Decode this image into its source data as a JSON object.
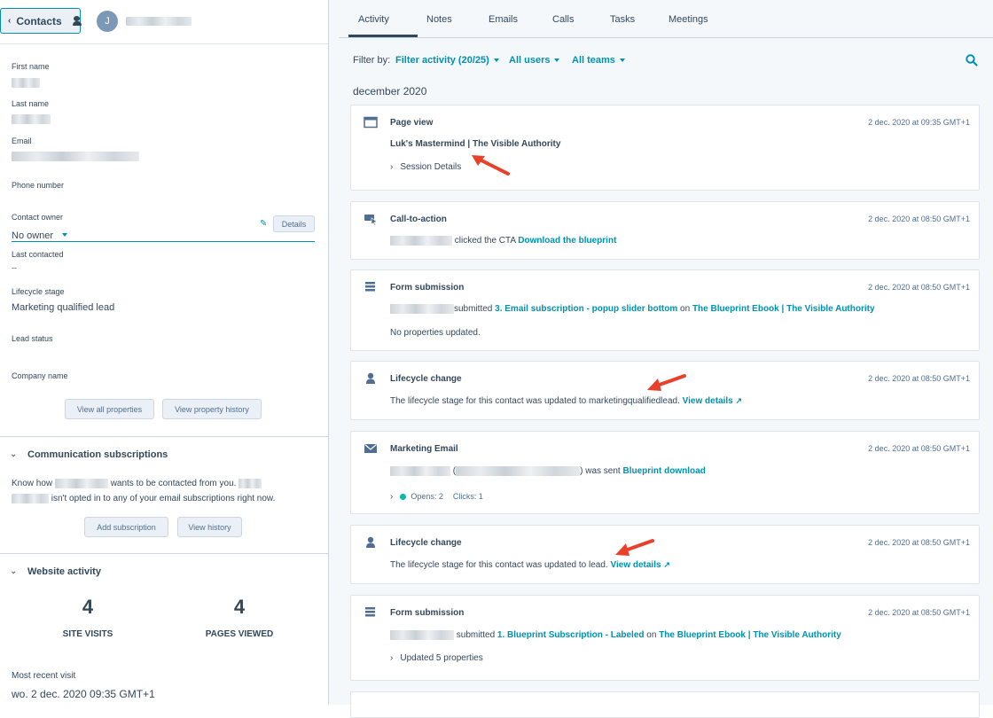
{
  "left": {
    "contacts_button": "Contacts",
    "avatar_initial": "J",
    "properties": [
      {
        "label": "First name",
        "value": ""
      },
      {
        "label": "Last name",
        "value": ""
      },
      {
        "label": "Email",
        "value": ""
      },
      {
        "label": "Phone number",
        "value": ""
      },
      {
        "label": "Contact owner",
        "value": "No owner"
      },
      {
        "label": "Last contacted",
        "value": "--"
      },
      {
        "label": "Lifecycle stage",
        "value": "Marketing qualified lead"
      },
      {
        "label": "Lead status",
        "value": ""
      },
      {
        "label": "Company name",
        "value": ""
      }
    ],
    "details_button": "Details",
    "view_all_properties": "View all properties",
    "view_property_history": "View property history",
    "comm": {
      "title": "Communication subscriptions",
      "text1a": "Know how",
      "text1b": "wants to be contacted from you.",
      "text2": "isn't opted in to any of your email subscriptions right now.",
      "add_subscription": "Add subscription",
      "view_history": "View history"
    },
    "website": {
      "title": "Website activity",
      "site_visits_value": "4",
      "site_visits_label": "SITE VISITS",
      "pages_viewed_value": "4",
      "pages_viewed_label": "PAGES VIEWED",
      "most_recent_label": "Most recent visit",
      "most_recent_value": "wo. 2 dec. 2020 09:35 GMT+1"
    }
  },
  "right": {
    "tabs": [
      "Activity",
      "Notes",
      "Emails",
      "Calls",
      "Tasks",
      "Meetings"
    ],
    "filter_by": "Filter by:",
    "filter_activity": "Filter activity (20/25)",
    "all_users": "All users",
    "all_teams": "All teams",
    "month": "december 2020",
    "cards": [
      {
        "icon": "browser-window-icon",
        "title": "Page view",
        "time": "2 dec. 2020 at 09:35 GMT+1",
        "link": "Luk's Mastermind | The Visible Authority",
        "sub": "Session Details"
      },
      {
        "icon": "cta-cursor-icon",
        "title": "Call-to-action",
        "time": "2 dec. 2020 at 08:50 GMT+1",
        "text": "clicked the CTA",
        "link": "Download the blueprint"
      },
      {
        "icon": "form-icon",
        "title": "Form submission",
        "time": "2 dec. 2020 at 08:50 GMT+1",
        "text": "submitted",
        "link": "3. Email subscription - popup slider bottom",
        "on": "on",
        "link2": "The Blueprint Ebook | The Visible Authority",
        "sub": "No properties updated."
      },
      {
        "icon": "person-icon",
        "title": "Lifecycle change",
        "time": "2 dec. 2020 at 08:50 GMT+1",
        "text": "The lifecycle stage for this contact was updated to marketingqualifiedlead.",
        "link": "View details"
      },
      {
        "icon": "envelope-icon",
        "title": "Marketing Email",
        "time": "2 dec. 2020 at 08:50 GMT+1",
        "text_a": "(",
        "text_b": ") was sent",
        "link": "Blueprint download",
        "opens": "Opens: 2",
        "clicks": "Clicks: 1"
      },
      {
        "icon": "person-icon",
        "title": "Lifecycle change",
        "time": "2 dec. 2020 at 08:50 GMT+1",
        "text": "The lifecycle stage for this contact was updated to lead.",
        "link": "View details"
      },
      {
        "icon": "form-icon",
        "title": "Form submission",
        "time": "2 dec. 2020 at 08:50 GMT+1",
        "text": "submitted",
        "link": "1. Blueprint Subscription - Labeled",
        "on": "on",
        "link2": "The Blueprint Ebook | The Visible Authority",
        "sub": "Updated 5 properties"
      }
    ],
    "colors": {
      "accent": "#0091ae",
      "text": "#33475b",
      "arrow": "#e8402a",
      "opens_dot": "#00bda5"
    }
  }
}
